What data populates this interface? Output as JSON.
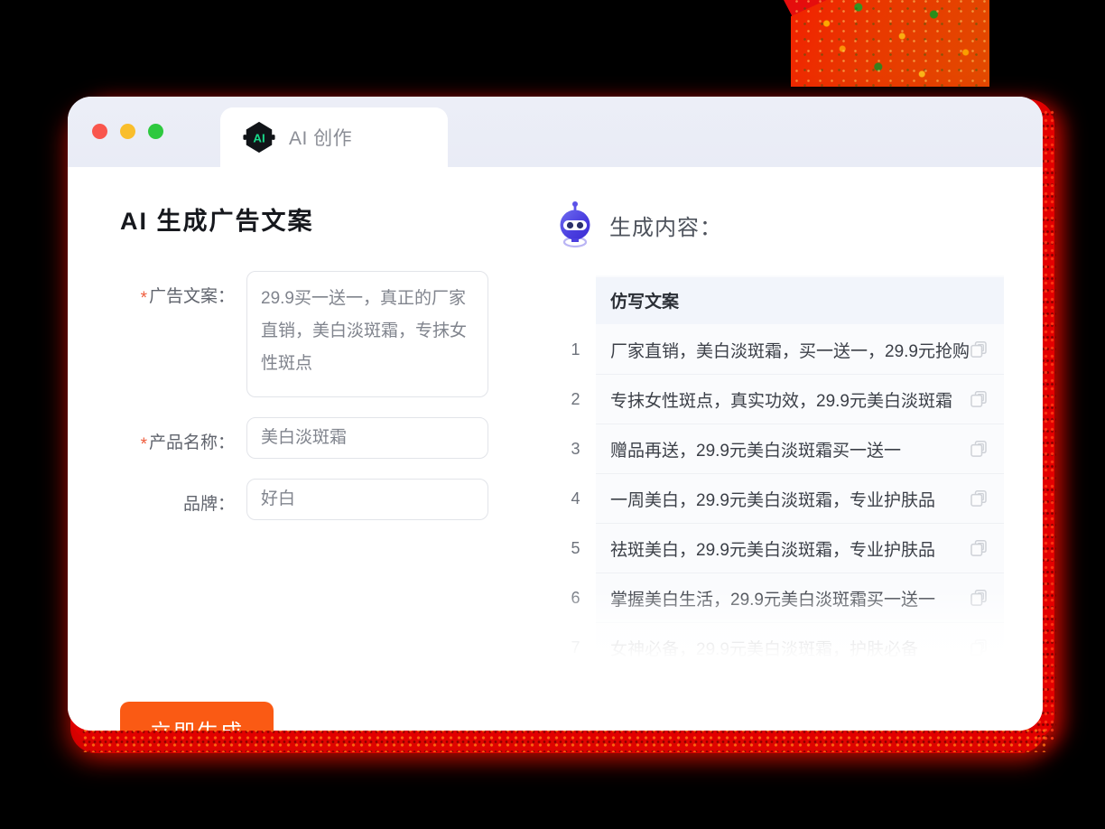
{
  "window": {
    "traffic_lights": [
      {
        "name": "close",
        "color": "#f9564d"
      },
      {
        "name": "minimize",
        "color": "#f9be2c"
      },
      {
        "name": "maximize",
        "color": "#2ec93f"
      }
    ],
    "tab": {
      "label": "AI 创作",
      "icon": "ai-hexagon-icon",
      "icon_text": "AI"
    }
  },
  "left": {
    "title": "AI 生成广告文案",
    "fields": [
      {
        "label": "广告文案：",
        "required": true,
        "type": "textarea",
        "value": "29.9买一送一，真正的厂家直销，美白淡斑霜，专抹女性斑点"
      },
      {
        "label": "产品名称：",
        "required": true,
        "type": "input",
        "value": "美白淡斑霜"
      },
      {
        "label": "品牌：",
        "required": false,
        "type": "input",
        "value": "好白"
      }
    ],
    "submit_label": "立即生成",
    "submit_color": "#fa5a14"
  },
  "right": {
    "icon": "robot-icon",
    "title": "生成内容：",
    "table": {
      "header": "仿写文案",
      "rows": [
        {
          "num": "1",
          "text": "厂家直销，美白淡斑霜，买一送一，29.9元抢购"
        },
        {
          "num": "2",
          "text": "专抹女性斑点，真实功效，29.9元美白淡斑霜"
        },
        {
          "num": "3",
          "text": "赠品再送，29.9元美白淡斑霜买一送一"
        },
        {
          "num": "4",
          "text": "一周美白，29.9元美白淡斑霜，专业护肤品"
        },
        {
          "num": "5",
          "text": "祛斑美白，29.9元美白淡斑霜，专业护肤品"
        },
        {
          "num": "6",
          "text": "掌握美白生活，29.9元美白淡斑霜买一送一"
        },
        {
          "num": "7",
          "text": "女神必备，29.9元美白淡斑霜，护肤必备"
        }
      ]
    }
  }
}
